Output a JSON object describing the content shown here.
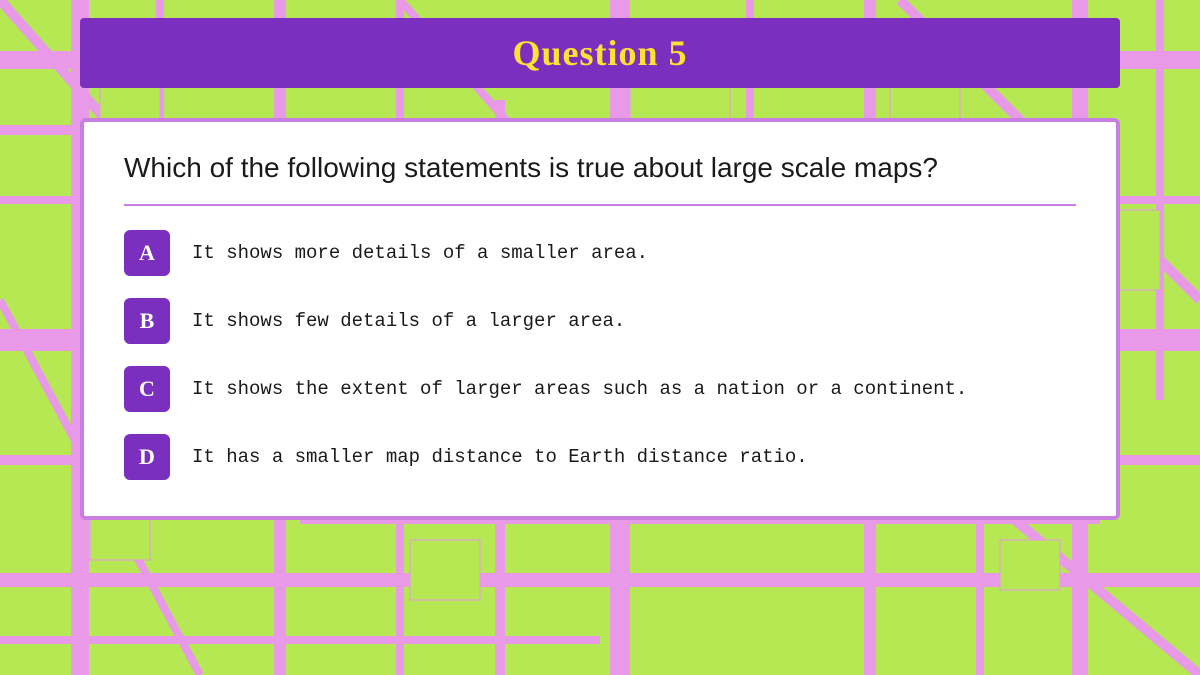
{
  "header": {
    "title": "Question 5",
    "bg_color": "#7B2FBE",
    "text_color": "#FFE135"
  },
  "question": {
    "text": "Which of the following statements is true about large scale maps?"
  },
  "answers": [
    {
      "label": "A",
      "text": "It shows more details of a smaller area."
    },
    {
      "label": "B",
      "text": "It shows few details of a larger area."
    },
    {
      "label": "C",
      "text": "It shows the extent of larger areas such as a nation or a continent."
    },
    {
      "label": "D",
      "text": "It has a smaller map distance to Earth distance ratio."
    }
  ],
  "background": {
    "color": "#b5e853",
    "road_color": "#e899e8"
  }
}
